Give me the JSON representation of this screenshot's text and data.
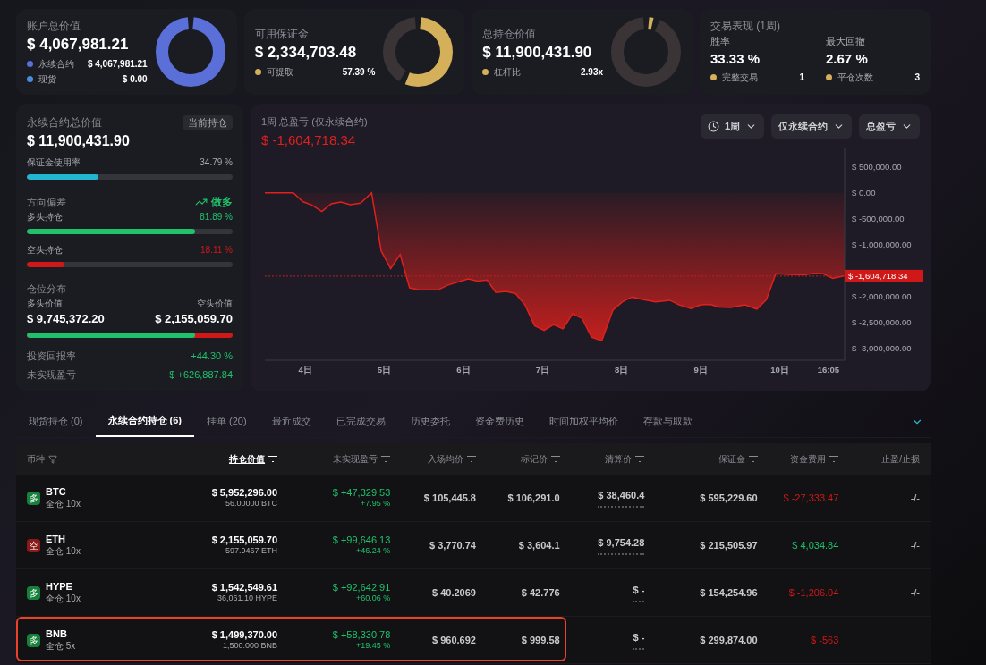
{
  "summary_cards": [
    {
      "kind": "donut",
      "title": "账户总价值",
      "value": "$ 4,067,981.21",
      "legend": [
        {
          "label": "永续合约",
          "value": "$ 4,067,981.21",
          "color": "#5b6fd8"
        },
        {
          "label": "现货",
          "value": "$ 0.00",
          "color": "#4a8de0"
        }
      ]
    },
    {
      "kind": "donut",
      "title": "可用保证金",
      "value": "$ 2,334,703.48",
      "legend": [
        {
          "label": "可提取",
          "value": "57.39 %",
          "color": "#d4b05a"
        }
      ]
    },
    {
      "kind": "donut",
      "title": "总持仓价值",
      "value": "$ 11,900,431.90",
      "legend": [
        {
          "label": "杠杆比",
          "value": "2.93x",
          "color": "#d4b05a"
        }
      ]
    },
    {
      "kind": "stats",
      "title": "交易表现 (1周)",
      "stats": [
        {
          "label": "胜率",
          "value": "33.33 %",
          "sub_label": "完整交易",
          "sub_value": "1",
          "color": "#d4b05a"
        },
        {
          "label": "最大回撤",
          "value": "2.67 %",
          "sub_label": "平仓次数",
          "sub_value": "3",
          "color": "#d4b05a"
        }
      ]
    }
  ],
  "perp_panel": {
    "title": "永续合约总价值",
    "badge": "当前持仓",
    "value": "$ 11,900,431.90",
    "margin_usage": {
      "label": "保证金使用率",
      "reading": "34.79 %",
      "level": 0.3479
    },
    "direction": {
      "label": "方向偏差",
      "trend": "做多"
    },
    "long": {
      "label": "多头持仓",
      "reading": "81.89 %",
      "level": 0.8189
    },
    "short": {
      "label": "空头持仓",
      "reading": "18.11 %",
      "level": 0.1811
    },
    "distribution": {
      "title": "仓位分布",
      "long_label": "多头价值",
      "short_label": "空头价值",
      "long_value": "$ 9,745,372.20",
      "short_value": "$ 2,155,059.70",
      "level": 0.8189
    },
    "metrics": [
      {
        "label": "投资回报率",
        "value": "+44.30 %"
      },
      {
        "label": "未实现盈亏",
        "value": "$ +626,887.84"
      }
    ]
  },
  "pnl_chart": {
    "title": "1周 总盈亏 (仅永续合约)",
    "value": "$ -1,604,718.34",
    "filters": [
      {
        "label": "1周",
        "kind": "period"
      },
      {
        "label": "仅永续合约",
        "kind": "plain"
      },
      {
        "label": "总盈亏",
        "kind": "plain"
      }
    ],
    "end_time_label": "16:05",
    "chart_data": {
      "type": "area",
      "x": [
        3.49,
        3.85,
        3.97,
        4.09,
        4.21,
        4.33,
        4.45,
        4.57,
        4.7,
        4.84,
        4.96,
        5.08,
        5.2,
        5.32,
        5.44,
        5.68,
        5.8,
        5.95,
        6.06,
        6.18,
        6.3,
        6.41,
        6.54,
        6.66,
        6.78,
        6.9,
        7.02,
        7.14,
        7.26,
        7.38,
        7.5,
        7.62,
        7.75,
        7.89,
        8.01,
        8.13,
        8.28,
        8.43,
        8.61,
        8.73,
        8.88,
        9.0,
        9.12,
        9.23,
        9.38,
        9.56,
        9.71,
        9.83,
        9.95,
        10.1,
        10.31,
        10.43,
        10.55,
        10.67,
        10.82
      ],
      "series": [
        {
          "color": "#e0201c",
          "values": [
            0,
            0,
            -170000,
            -240000,
            -360000,
            -210000,
            -180000,
            -230000,
            -200000,
            0,
            -1120000,
            -1460000,
            -1190000,
            -1830000,
            -1870000,
            -1870000,
            -1780000,
            -1710000,
            -1660000,
            -1700000,
            -1680000,
            -1920000,
            -1900000,
            -1940000,
            -2160000,
            -2560000,
            -2650000,
            -2540000,
            -2620000,
            -2330000,
            -2420000,
            -2780000,
            -2850000,
            -2260000,
            -2100000,
            -2010000,
            -2060000,
            -2100000,
            -2070000,
            -2160000,
            -2230000,
            -2160000,
            -2150000,
            -2200000,
            -2210000,
            -2160000,
            -2240000,
            -2060000,
            -1560000,
            -1570000,
            -1580000,
            -1550000,
            -1560000,
            -1650000,
            -1600000
          ]
        }
      ],
      "ref_lines": [
        {
          "axis": "y",
          "value": -1604718.34,
          "label": "$ -1,604,718.34"
        }
      ],
      "xlim": [
        3.49,
        10.82
      ],
      "ylim": [
        -3225000,
        855000
      ],
      "xticks": [
        {
          "value": 4,
          "label": "4日"
        },
        {
          "value": 5,
          "label": "5日"
        },
        {
          "value": 6,
          "label": "6日"
        },
        {
          "value": 7,
          "label": "7日"
        },
        {
          "value": 8,
          "label": "8日"
        },
        {
          "value": 9,
          "label": "9日"
        },
        {
          "value": 10,
          "label": "10日"
        }
      ],
      "yticks": [
        {
          "value": 500000,
          "label": "$ 500,000.00"
        },
        {
          "value": 0,
          "label": "$ 0.00"
        },
        {
          "value": -500000,
          "label": "$ -500,000.00"
        },
        {
          "value": -1000000,
          "label": "$ -1,000,000.00"
        },
        {
          "value": -2000000,
          "label": "$ -2,000,000.00"
        },
        {
          "value": -2500000,
          "label": "$ -2,500,000.00"
        },
        {
          "value": -3000000,
          "label": "$ -3,000,000.00"
        }
      ]
    }
  },
  "tabs": [
    {
      "label": "现货持仓 (0)",
      "selected": false
    },
    {
      "label": "永续合约持仓 (6)",
      "selected": true
    },
    {
      "label": "挂单 (20)",
      "selected": false
    },
    {
      "label": "最近成交",
      "selected": false
    },
    {
      "label": "已完成交易",
      "selected": false
    },
    {
      "label": "历史委托",
      "selected": false
    },
    {
      "label": "资金费历史",
      "selected": false
    },
    {
      "label": "时间加权平均价",
      "selected": false
    },
    {
      "label": "存款与取款",
      "selected": false
    }
  ],
  "table": {
    "columns": [
      {
        "label": "币种",
        "filter": true,
        "sort": false,
        "selected": false
      },
      {
        "label": "持仓价值",
        "filter": false,
        "sort": true,
        "selected": true
      },
      {
        "label": "未实现盈亏",
        "filter": false,
        "sort": true,
        "selected": false
      },
      {
        "label": "入场均价",
        "filter": false,
        "sort": true,
        "selected": false
      },
      {
        "label": "标记价",
        "filter": false,
        "sort": true,
        "selected": false
      },
      {
        "label": "清算价",
        "filter": false,
        "sort": true,
        "selected": false
      },
      {
        "label": "保证金",
        "filter": false,
        "sort": true,
        "selected": false
      },
      {
        "label": "资金费用",
        "filter": false,
        "sort": true,
        "selected": false
      },
      {
        "label": "止盈/止损",
        "filter": false,
        "sort": false,
        "selected": false
      }
    ],
    "rows": [
      {
        "side": {
          "label": "多",
          "color": "#16803c"
        },
        "coin": "BTC",
        "mode": "全仓 10x",
        "value": "$ 5,952,296.00",
        "size": "56.00000 BTC",
        "pnl": "$ +47,329.53",
        "pnl_pct": "+7.95 %",
        "entry": "$ 105,445.8",
        "mark": "$ 106,291.0",
        "liq": "$ 38,460.4",
        "margin": "$ 595,229.60",
        "funding": {
          "text": "$ -27,333.47",
          "color": "#d01818"
        },
        "tpsl": "-/-",
        "highlighted": false
      },
      {
        "side": {
          "label": "空",
          "color": "#8a1a1a"
        },
        "coin": "ETH",
        "mode": "全仓 10x",
        "value": "$ 2,155,059.70",
        "size": "-597.9467 ETH",
        "pnl": "$ +99,646.13",
        "pnl_pct": "+46.24 %",
        "entry": "$ 3,770.74",
        "mark": "$ 3,604.1",
        "liq": "$ 9,754.28",
        "margin": "$ 215,505.97",
        "funding": {
          "text": "$ 4,034.84",
          "color": "#1fc16b"
        },
        "tpsl": "-/-",
        "highlighted": false
      },
      {
        "side": {
          "label": "多",
          "color": "#16803c"
        },
        "coin": "HYPE",
        "mode": "全仓 10x",
        "value": "$ 1,542,549.61",
        "size": "36,061.10 HYPE",
        "pnl": "$ +92,642.91",
        "pnl_pct": "+60.06 %",
        "entry": "$ 40.2069",
        "mark": "$ 42.776",
        "liq": "$ -",
        "margin": "$ 154,254.96",
        "funding": {
          "text": "$ -1,206.04",
          "color": "#d01818"
        },
        "tpsl": "-/-",
        "highlighted": false
      },
      {
        "side": {
          "label": "多",
          "color": "#16803c"
        },
        "coin": "BNB",
        "mode": "全仓 5x",
        "value": "$ 1,499,370.00",
        "size": "1,500.000 BNB",
        "pnl": "$ +58,330.78",
        "pnl_pct": "+19.45 %",
        "entry": "$ 960.692",
        "mark": "$ 999.58",
        "liq": "$ -",
        "margin": "$ 299,874.00",
        "funding": {
          "text": "$ -563",
          "color": "#d01818"
        },
        "highlighted": true
      }
    ]
  }
}
